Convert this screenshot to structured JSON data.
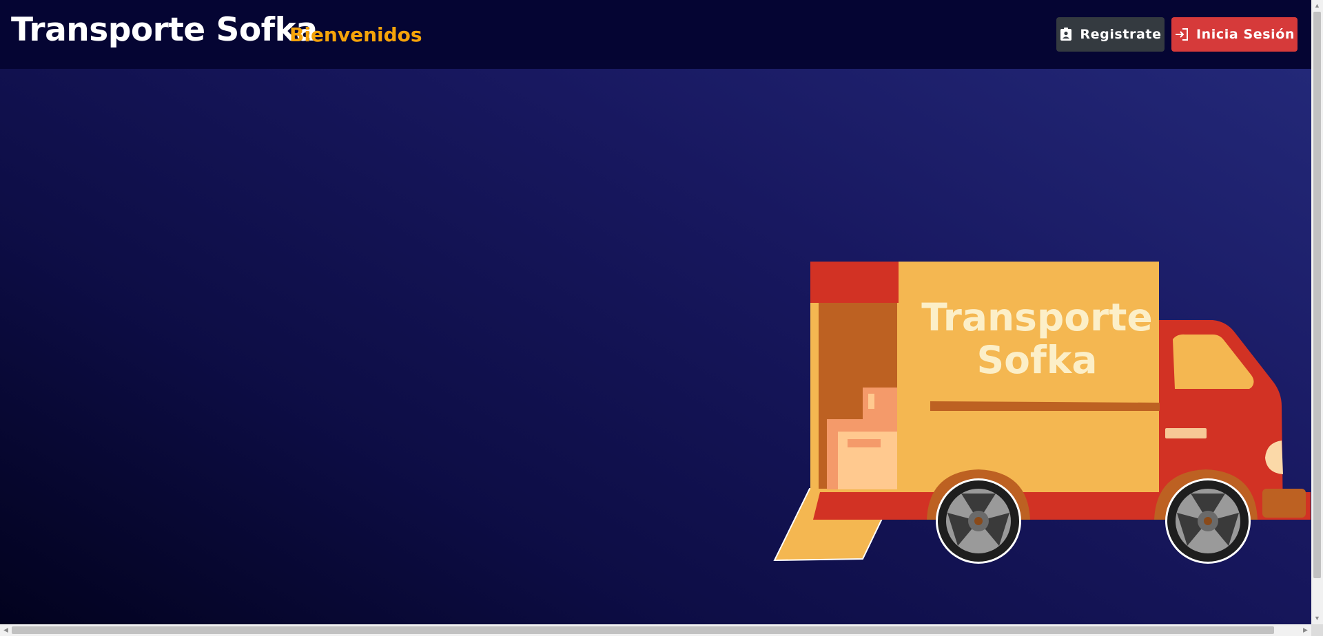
{
  "navbar": {
    "brand": "Transporte Sofka",
    "welcome": "Bienvenidos",
    "register_label": "Registrate",
    "register_icon": "contact-id-icon",
    "login_label": "Inicia Sesión",
    "login_icon": "login-icon"
  },
  "hero": {
    "truck_text_line1": "Transporte",
    "truck_text_line2": "Sofka"
  },
  "colors": {
    "navbar_bg": "#050533",
    "welcome": "#f5a30a",
    "register_bg": "#343a40",
    "login_bg": "#d63a3a",
    "truck_box": "#f4b751",
    "truck_cab": "#d23224"
  }
}
